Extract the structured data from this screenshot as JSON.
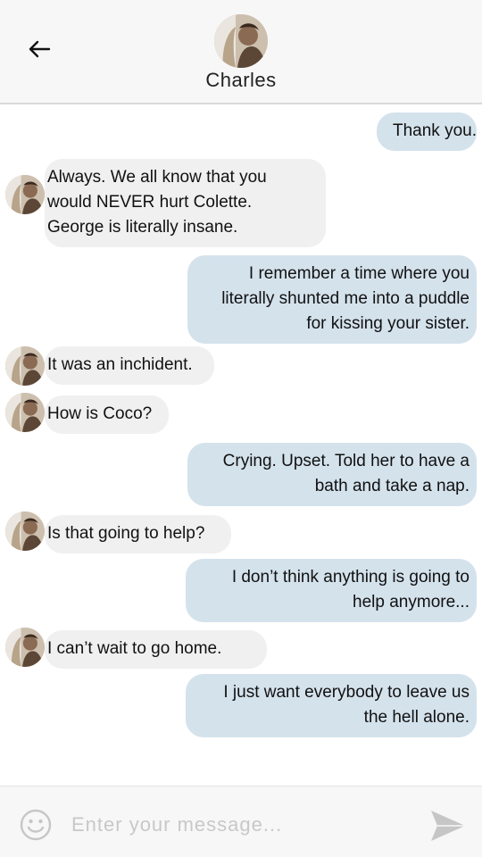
{
  "header": {
    "contact_name": "Charles",
    "back_icon": "arrow-left-icon"
  },
  "messages": [
    {
      "side": "out",
      "lines": [
        "Thank you."
      ]
    },
    {
      "side": "in",
      "lines": [
        "Always. We all know that you",
        "would NEVER hurt Colette.",
        "George is literally insane."
      ]
    },
    {
      "side": "out",
      "lines": [
        "I remember a time where you",
        "literally shunted me into a puddle",
        "for kissing your sister."
      ]
    },
    {
      "side": "in",
      "lines": [
        "It was an inchident."
      ]
    },
    {
      "side": "in",
      "lines": [
        "How is Coco?"
      ]
    },
    {
      "side": "out",
      "lines": [
        "Crying. Upset. Told her to have a",
        "bath and take a nap."
      ]
    },
    {
      "side": "in",
      "lines": [
        "Is that going to help?"
      ]
    },
    {
      "side": "out",
      "lines": [
        "I don’t think anything is going to",
        "help anymore..."
      ]
    },
    {
      "side": "in",
      "lines": [
        "I can’t wait to go home."
      ]
    },
    {
      "side": "out",
      "lines": [
        "I just want everybody to leave us",
        "the hell alone."
      ]
    }
  ],
  "composer": {
    "placeholder": "Enter your message...",
    "value": "",
    "emoji_icon": "smiley-icon",
    "send_icon": "send-icon"
  },
  "colors": {
    "incoming_bubble": "#f0f0f0",
    "outgoing_bubble": "#d4e2ec",
    "header_bg": "#f7f7f7"
  }
}
